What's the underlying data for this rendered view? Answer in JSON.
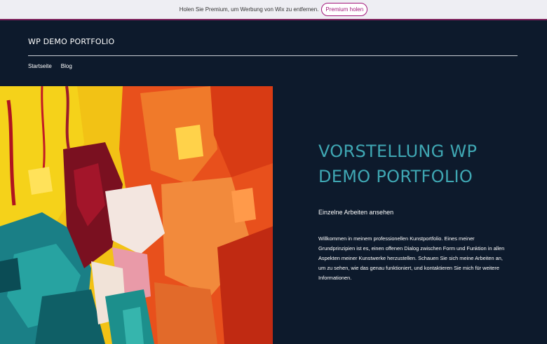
{
  "wix_banner": {
    "message": "Holen Sie Premium, um Werbung von Wix zu entfernen.",
    "button_label": "Premium holen"
  },
  "header": {
    "site_title": "WP DEMO PORTFOLIO",
    "nav": [
      {
        "label": "Startseite"
      },
      {
        "label": "Blog"
      }
    ]
  },
  "main": {
    "heading": "VORSTELLUNG WP DEMO PORTFOLIO",
    "subheading": "Einzelne Arbeiten ansehen",
    "body": "Willkommen in meinem professionellen Kunstportfolio. Eines meiner Grundprinzipien ist es, einen offenen Dialog zwischen Form und Funktion in allen Aspekten meiner Kunstwerke herzustellen. Schauen Sie sich meine Arbeiten an, um zu sehen, wie das genau funktioniert, und kontaktieren Sie mich für weitere Informationen."
  },
  "colors": {
    "page_background": "#0d1a2c",
    "heading_accent": "#3fa7b3",
    "wix_accent": "#a2157a"
  }
}
